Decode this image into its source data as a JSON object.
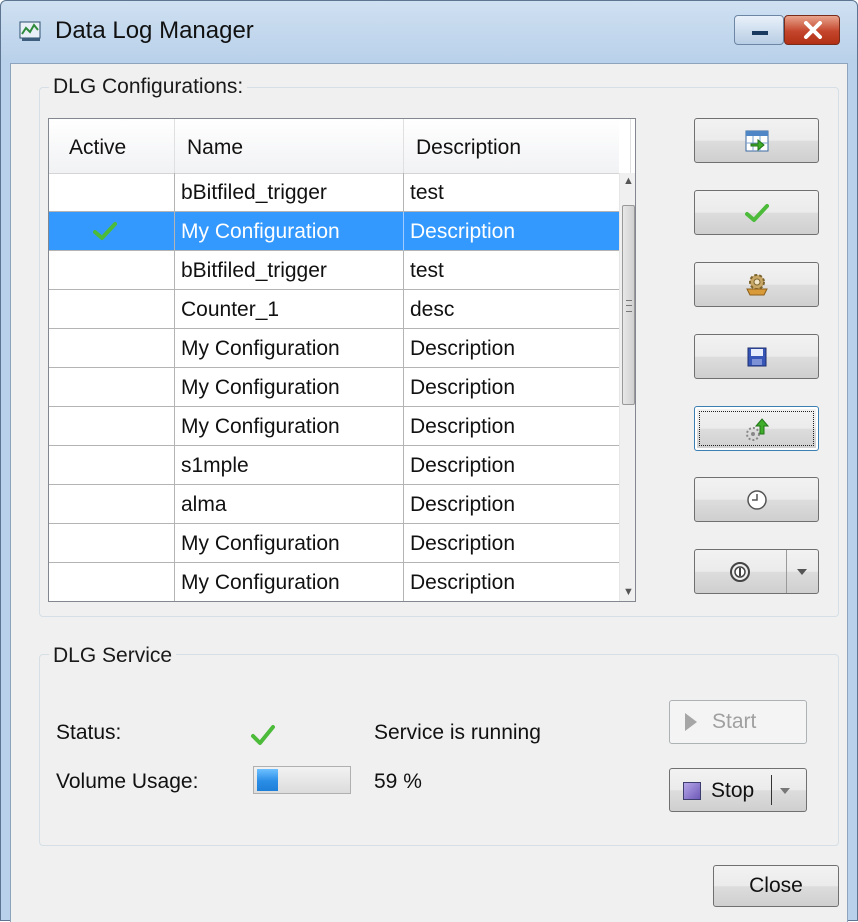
{
  "window": {
    "title": "Data Log Manager"
  },
  "configurations": {
    "group_label": "DLG Configurations:",
    "columns": [
      "Active",
      "Name",
      "Description"
    ],
    "rows": [
      {
        "active": false,
        "name": "bBitfiled_trigger",
        "description": "test",
        "selected": false
      },
      {
        "active": true,
        "name": "My Configuration",
        "description": "Description",
        "selected": true
      },
      {
        "active": false,
        "name": "bBitfiled_trigger",
        "description": "test",
        "selected": false
      },
      {
        "active": false,
        "name": "Counter_1",
        "description": "desc",
        "selected": false
      },
      {
        "active": false,
        "name": "My Configuration",
        "description": "Description",
        "selected": false
      },
      {
        "active": false,
        "name": "My Configuration",
        "description": "Description",
        "selected": false
      },
      {
        "active": false,
        "name": "My Configuration",
        "description": "Description",
        "selected": false
      },
      {
        "active": false,
        "name": "s1mple",
        "description": "Description",
        "selected": false
      },
      {
        "active": false,
        "name": "alma",
        "description": "Description",
        "selected": false
      },
      {
        "active": false,
        "name": "My Configuration",
        "description": "Description",
        "selected": false
      },
      {
        "active": false,
        "name": "My Configuration",
        "description": "Description",
        "selected": false
      }
    ],
    "side_buttons": [
      "export-table-icon",
      "activate-check-icon",
      "settings-gear-icon",
      "save-disk-icon",
      "upload-config-icon",
      "schedule-clock-icon",
      "info-icon"
    ]
  },
  "service": {
    "group_label": "DLG Service",
    "status_label": "Status:",
    "status_text": "Service is running",
    "volume_label": "Volume Usage:",
    "volume_percent": 59,
    "volume_text": "59 %",
    "start_label": "Start",
    "stop_label": "Stop"
  },
  "close_label": "Close",
  "colors": {
    "selection": "#3399ff",
    "check": "#4cbb3a",
    "progress": "#2a8de6",
    "close_button": "#c3452b"
  }
}
